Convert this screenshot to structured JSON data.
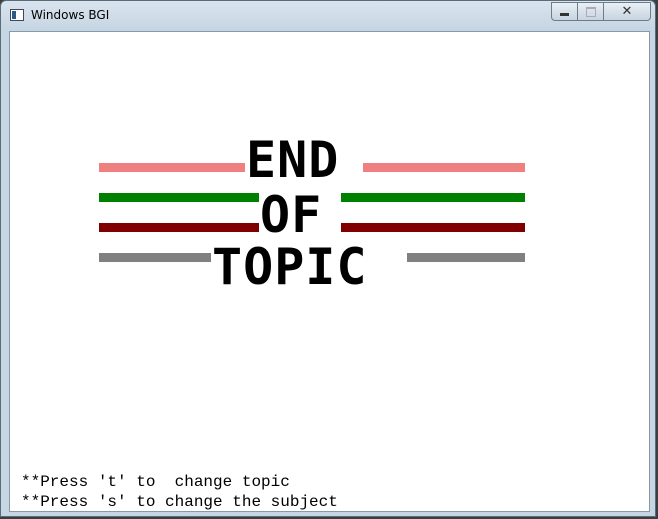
{
  "window": {
    "title": "Windows BGI",
    "controls": {
      "minimize": "minimize",
      "maximize": "maximize",
      "close": "close"
    }
  },
  "screen": {
    "words": [
      "END",
      "OF",
      "TOPIC"
    ],
    "bar_colors": {
      "pink": "#f08080",
      "green": "#008000",
      "dark_red": "#800000",
      "gray": "#808080"
    },
    "hints": [
      "**Press 't' to  change topic",
      "**Press 's' to change the subject"
    ]
  }
}
